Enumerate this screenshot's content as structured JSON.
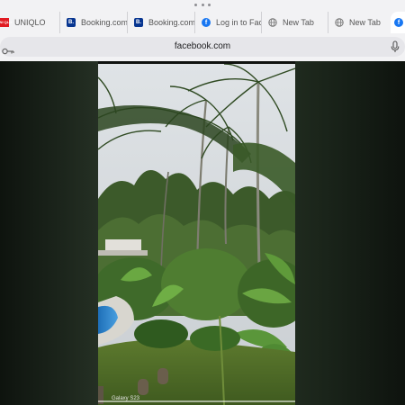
{
  "window": {
    "more_dots_icon": "ellipsis-icon"
  },
  "tabs": [
    {
      "label": "UNIQLO",
      "icon": "uniqlo-logo-icon",
      "favicon_text": "UNI QLO",
      "active": false
    },
    {
      "label": "Booking.com",
      "icon": "booking-icon",
      "favicon_text": "B.",
      "active": false
    },
    {
      "label": "Booking.com",
      "icon": "booking-icon",
      "favicon_text": "B.",
      "active": false
    },
    {
      "label": "Log in to Facebook",
      "icon": "facebook-icon",
      "favicon_text": "f",
      "active": false
    },
    {
      "label": "New Tab",
      "icon": "globe-icon",
      "favicon_text": "",
      "active": false
    },
    {
      "label": "New Tab",
      "icon": "globe-icon",
      "favicon_text": "",
      "active": false
    },
    {
      "label": "",
      "icon": "facebook-icon",
      "favicon_text": "f",
      "active": true
    }
  ],
  "address_bar": {
    "url": "facebook.com",
    "left_icon": "key-icon",
    "right_icon": "microphone-icon"
  },
  "video": {
    "description_icon": "tropical-garden-video",
    "watermark": "Galaxy S23"
  },
  "colors": {
    "chrome_bg": "#f2f2f4",
    "address_pill": "#e6e6ea",
    "facebook_blue": "#1877f2",
    "booking_blue": "#073590",
    "uniqlo_red": "#e11b22"
  }
}
